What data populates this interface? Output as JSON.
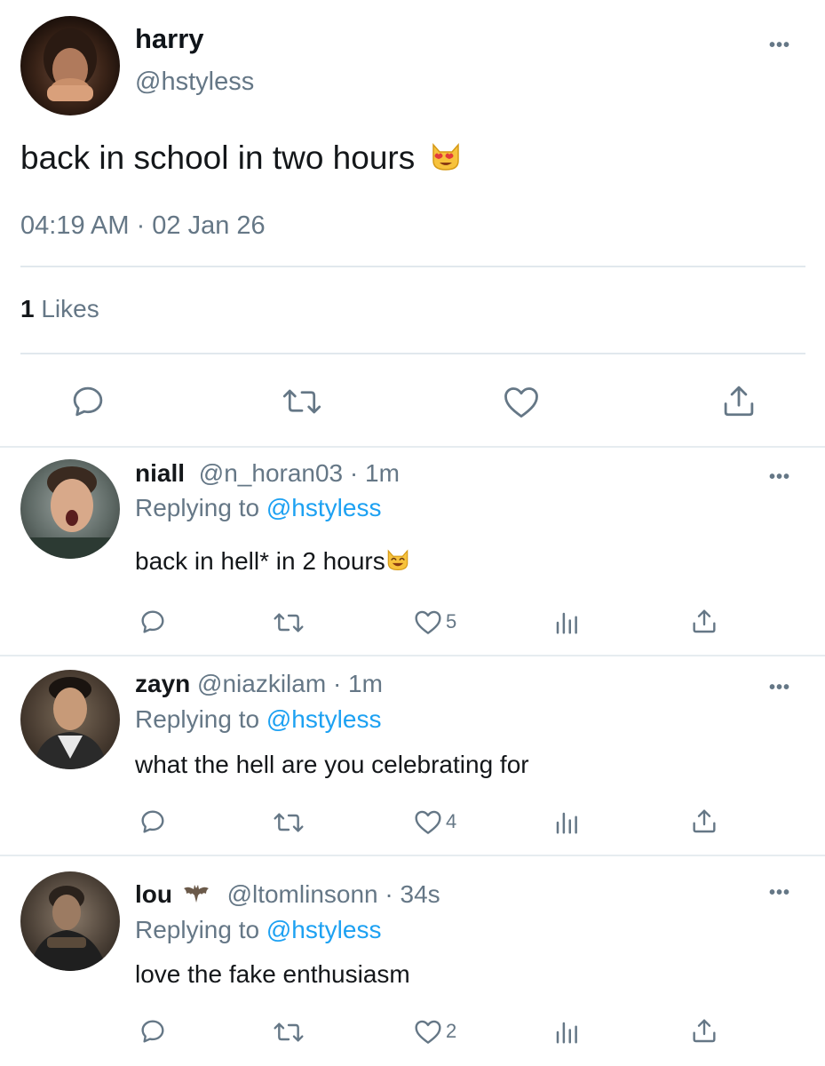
{
  "main_tweet": {
    "name": "harry",
    "handle": "@hstyless",
    "text": "back in school in two hours",
    "emoji": "heart-eyes-cat",
    "timestamp": "04:19 AM · 02 Jan 26",
    "likes_count": "1",
    "likes_label": "Likes"
  },
  "replies": [
    {
      "name": "niall",
      "handle": "@n_horan03",
      "time": "· 1m",
      "replying_prefix": "Replying to",
      "replying_handle": "@hstyless",
      "text": "back in hell* in 2 hours",
      "emoji": "smiling-cat",
      "like_count": "5"
    },
    {
      "name": "zayn",
      "handle": "@niazkilam",
      "time": "· 1m",
      "replying_prefix": "Replying to",
      "replying_handle": "@hstyless",
      "text": "what the hell are you celebrating for",
      "like_count": "4"
    },
    {
      "name": "lou",
      "name_emoji": "bat",
      "handle": "@ltomlinsonn",
      "time": "· 34s",
      "replying_prefix": "Replying to",
      "replying_handle": "@hstyless",
      "text": "love the fake enthusiasm",
      "like_count": "2"
    }
  ],
  "more_glyph": "•••",
  "colors": {
    "link": "#1da1f2",
    "muted": "#657786",
    "divider": "#e1e8ed",
    "text": "#14171a"
  }
}
